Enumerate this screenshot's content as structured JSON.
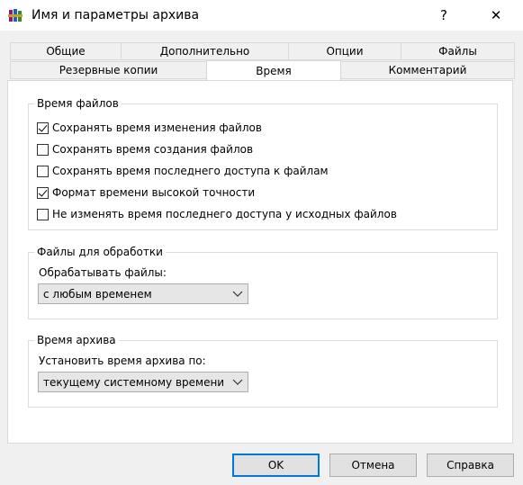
{
  "window": {
    "title": "Имя и параметры архива",
    "help_glyph": "?",
    "close_glyph": "✕"
  },
  "tabs_row1": [
    {
      "label": "Общие"
    },
    {
      "label": "Дополнительно"
    },
    {
      "label": "Опции"
    },
    {
      "label": "Файлы"
    }
  ],
  "tabs_row2": [
    {
      "label": "Резервные копии"
    },
    {
      "label": "Время",
      "active": true
    },
    {
      "label": "Комментарий"
    }
  ],
  "file_times": {
    "legend": "Время файлов",
    "options": [
      {
        "label": "Сохранять время изменения файлов",
        "checked": true
      },
      {
        "label": "Сохранять время создания файлов",
        "checked": false
      },
      {
        "label": "Сохранять время последнего доступа к файлам",
        "checked": false
      },
      {
        "label": "Формат времени высокой точности",
        "checked": true
      },
      {
        "label": "Не изменять время последнего доступа у исходных файлов",
        "checked": false
      }
    ]
  },
  "files_to_process": {
    "legend": "Файлы для обработки",
    "field_label": "Обрабатывать файлы:",
    "selected": "с любым временем"
  },
  "archive_time": {
    "legend": "Время архива",
    "field_label": "Установить время архива по:",
    "selected": "текущему системному времени"
  },
  "buttons": {
    "ok": "OK",
    "cancel": "Отмена",
    "help": "Справка"
  },
  "icons": {
    "app": "winrar-books-icon",
    "dropdown": "chevron-down-icon"
  }
}
